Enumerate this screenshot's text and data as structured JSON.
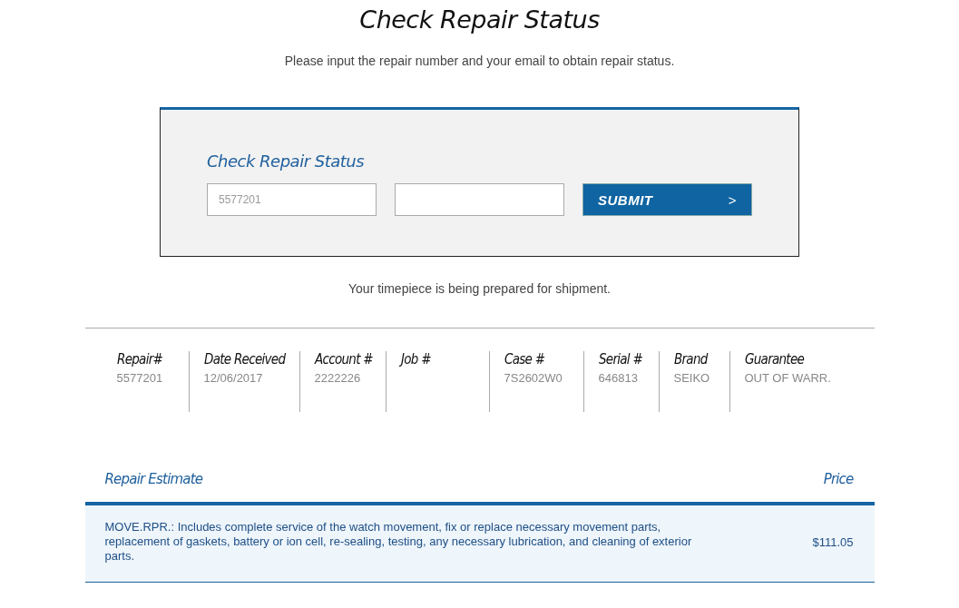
{
  "page": {
    "title": "Check Repair Status",
    "intro": "Please input the repair number and your email to obtain repair status."
  },
  "form": {
    "heading": "Check Repair Status",
    "repair_field": {
      "placeholder": "5577201"
    },
    "submit": {
      "label": "SUBMIT",
      "icon": ">"
    }
  },
  "status_message": "Your timepiece is being prepared for shipment.",
  "details": [
    {
      "label": "Repair#",
      "value": "5577201"
    },
    {
      "label": "Date Received",
      "value": "12/06/2017"
    },
    {
      "label": "Account #",
      "value": "2222226"
    },
    {
      "label": "Job #"
    },
    {
      "label": "Case #",
      "value": "7S2602W0"
    },
    {
      "label": "Serial #",
      "value": "646813"
    },
    {
      "label": "Brand",
      "value": "SEIKO"
    },
    {
      "label": "Guarantee",
      "value": "OUT OF WARR."
    }
  ],
  "estimate": {
    "columns": [
      "Repair Estimate",
      "Price"
    ],
    "rows": [
      {
        "description": "MOVE.RPR.: Includes complete service of the watch movement, fix or replace necessary movement parts, replacement of gaskets, battery or ion cell, re-sealing, testing, any necessary lubrication, and cleaning of exterior parts.",
        "price": "$111.05"
      }
    ]
  }
}
